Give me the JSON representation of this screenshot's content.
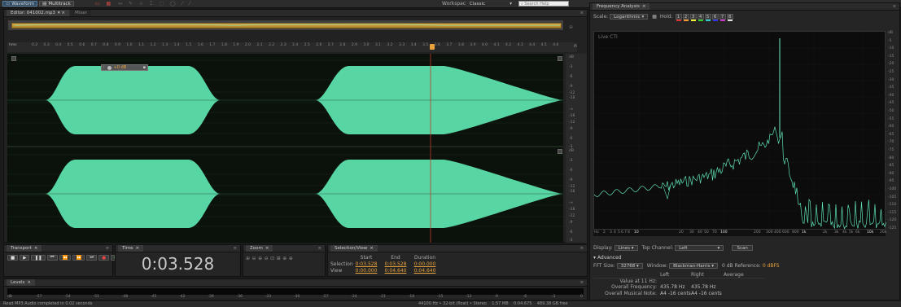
{
  "menubar": {
    "waveform": "Waveform",
    "multitrack": "Multitrack",
    "workspace_label": "Workspace:",
    "workspace_value": "Classic",
    "search_placeholder": "Search Help"
  },
  "editor": {
    "tab": "Editor: 041002.mp3",
    "mixer": "Mixer"
  },
  "timeline": {
    "unit": "hms",
    "ticks": [
      "0.2",
      "0.3",
      "0.4",
      "0.5",
      "0.6",
      "0.7",
      "0.8",
      "0.9",
      "1.0",
      "1.1",
      "1.2",
      "1.3",
      "1.4",
      "1.5",
      "1.6",
      "1.7",
      "1.8",
      "1.9",
      "2.0",
      "2.1",
      "2.2",
      "2.3",
      "2.4",
      "2.5",
      "2.6",
      "2.7",
      "2.8",
      "2.9",
      "3.0",
      "3.1",
      "3.2",
      "3.3",
      "3.4",
      "3.5",
      "3.6",
      "3.7",
      "3.8",
      "3.9",
      "4.0",
      "4.1",
      "4.2",
      "4.3",
      "4.4",
      "4.5",
      "4.6"
    ]
  },
  "hud": {
    "value": "+0 dB"
  },
  "db_scale": [
    "dB",
    "-3",
    "-6",
    "-9",
    "-12",
    "-18",
    "-∞",
    "-18",
    "-12",
    "-9",
    "-6",
    "-3"
  ],
  "transport": {
    "title": "Transport"
  },
  "time": {
    "title": "Time",
    "display": "0:03.528"
  },
  "zoom": {
    "title": "Zoom"
  },
  "selection_view": {
    "title": "Selection/View",
    "headers": [
      "Start",
      "End",
      "Duration"
    ],
    "rows": [
      {
        "label": "Selection",
        "start": "0:03.528",
        "end": "0:03.528",
        "duration": "0:00.000"
      },
      {
        "label": "View",
        "start": "0:00.000",
        "end": "0:04.640",
        "duration": "0:04.640"
      }
    ]
  },
  "levels": {
    "title": "Levels",
    "ticks": [
      "dB",
      "-57",
      "-54",
      "-51",
      "-48",
      "-45",
      "-42",
      "-39",
      "-36",
      "-33",
      "-30",
      "-27",
      "-24",
      "-21",
      "-18",
      "-15",
      "-12",
      "-9",
      "-6",
      "-3",
      "0"
    ]
  },
  "status": {
    "left": "Read MP3 Audio completed in 0.02 seconds",
    "right": "44100 Hz • 32-bit (float) • Stereo    1.57 MB    0:04.675    489.38 GB free"
  },
  "freq": {
    "title": "Frequency Analysis",
    "scale_label": "Scale:",
    "scale_value": "Logarithmic",
    "hold_label": "Hold:",
    "hold": [
      "1",
      "2",
      "3",
      "4",
      "5",
      "6",
      "7",
      "8"
    ],
    "hold_colors": [
      "#d33",
      "#e93",
      "#ee3",
      "#3c3",
      "#3cc",
      "#33e",
      "#c3c",
      "#ddd"
    ],
    "live_label": "Live CTI",
    "db_ticks": [
      "dB",
      "-5",
      "-10",
      "-15",
      "-20",
      "-25",
      "-30",
      "-35",
      "-40",
      "-45",
      "-50",
      "-55",
      "-60",
      "-65",
      "-70",
      "-75",
      "-80",
      "-85",
      "-90",
      "-95",
      "-100",
      "-105",
      "-110",
      "-115",
      "-120",
      "-125"
    ],
    "hz_ticks": [
      "Hz",
      "2",
      "3",
      "4",
      "5",
      "6",
      "7",
      "8",
      "10",
      "20",
      "30",
      "40",
      "50",
      "70",
      "100",
      "200",
      "300",
      "400",
      "600",
      "800",
      "1k",
      "2k",
      "3k",
      "4k",
      "5k",
      "6k",
      "10k",
      "20k"
    ],
    "display_label": "Display:",
    "display_value": "Lines",
    "top_channel_label": "Top Channel:",
    "top_channel_value": "Left",
    "scan": "Scan",
    "advanced": "Advanced",
    "fft_label": "FFT Size:",
    "fft_value": "32768",
    "window_label": "Window:",
    "window_value": "Blackman-Harris",
    "ref_label": "0 dB Reference:",
    "ref_value": "0 dBFS",
    "cols": [
      "Left",
      "Right",
      "Average"
    ],
    "rows": [
      {
        "label": "Value at 11 Hz:",
        "left": "",
        "right": "",
        "avg": ""
      },
      {
        "label": "Overall Frequency:",
        "left": "435.78 Hz",
        "right": "435.78 Hz",
        "avg": ""
      },
      {
        "label": "Overall Musical Note:",
        "left": "A4 -16 cents",
        "right": "A4 -16 cents",
        "avg": ""
      }
    ]
  }
}
